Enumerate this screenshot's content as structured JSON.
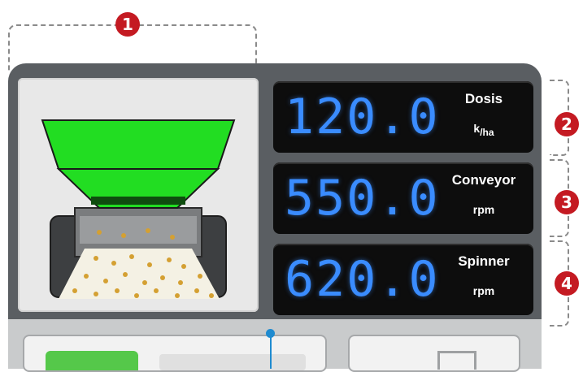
{
  "callouts": [
    "1",
    "2",
    "3",
    "4"
  ],
  "readouts": [
    {
      "value": "120.0",
      "label": "Dosis",
      "unit_main": "k",
      "unit_sub": "/ha"
    },
    {
      "value": "550.0",
      "label": "Conveyor",
      "unit_main": "rpm",
      "unit_sub": ""
    },
    {
      "value": "620.0",
      "label": "Spinner",
      "unit_main": "rpm",
      "unit_sub": ""
    }
  ],
  "colors": {
    "hopper": "#22dd22",
    "digits": "#3a8cff",
    "badge": "#c41a22",
    "panel": "#5a5e62"
  },
  "icons": [
    "spreader-machine-icon"
  ]
}
